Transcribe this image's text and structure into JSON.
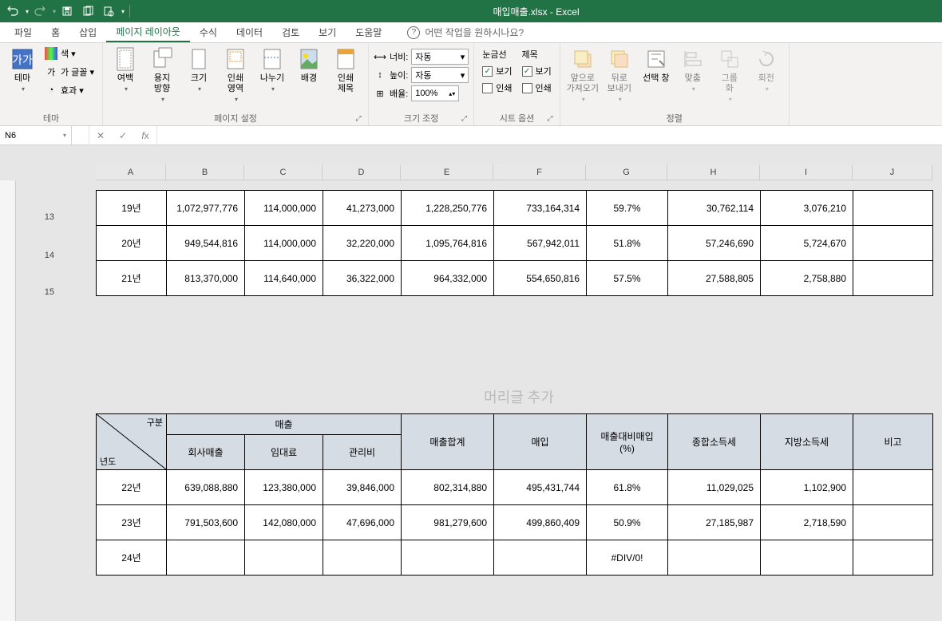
{
  "title": "매입매출.xlsx  -  Excel",
  "qat": {
    "undo": "↶",
    "redo": "↷",
    "save": "💾",
    "touch": "⎘",
    "preview": "🔍"
  },
  "tabs": [
    "파일",
    "홈",
    "삽입",
    "페이지 레이아웃",
    "수식",
    "데이터",
    "검토",
    "보기",
    "도움말"
  ],
  "active_tab": 3,
  "tell_me": "어떤 작업을 원하시나요?",
  "ribbon": {
    "theme": {
      "label": "테마",
      "btn": "테마",
      "colors": "색 ▾",
      "fonts": "가 글꼴 ▾",
      "effects": "효과 ▾"
    },
    "page_setup": {
      "label": "페이지 설정",
      "margins": "여백",
      "orient": "용지\n방향",
      "size": "크기",
      "area": "인쇄\n영역",
      "breaks": "나누기",
      "bg": "배경",
      "titles": "인쇄\n제목"
    },
    "scale": {
      "label": "크기 조정",
      "width": "너비:",
      "height": "높이:",
      "scale": "배율:",
      "auto": "자동",
      "pct": "100%"
    },
    "sheet_opts": {
      "label": "시트 옵션",
      "grid": "눈금선",
      "headings": "제목",
      "view": "보기",
      "print": "인쇄"
    },
    "arrange": {
      "label": "정렬",
      "forward": "앞으로\n가져오기",
      "back": "뒤로\n보내기",
      "selpane": "선택 창",
      "align": "맞춤",
      "group": "그룹\n화",
      "rotate": "회전"
    }
  },
  "namebox": "N6",
  "col_headers": [
    "A",
    "B",
    "C",
    "D",
    "E",
    "F",
    "G",
    "H",
    "I",
    "J"
  ],
  "row_numbers": [
    "13",
    "14",
    "15"
  ],
  "header_placeholder": "머리글 추가",
  "table1_rows": [
    {
      "year": "19년",
      "b": "1,072,977,776",
      "c": "114,000,000",
      "d": "41,273,000",
      "e": "1,228,250,776",
      "f": "733,164,314",
      "g": "59.7%",
      "h": "30,762,114",
      "i": "3,076,210"
    },
    {
      "year": "20년",
      "b": "949,544,816",
      "c": "114,000,000",
      "d": "32,220,000",
      "e": "1,095,764,816",
      "f": "567,942,011",
      "g": "51.8%",
      "h": "57,246,690",
      "i": "5,724,670"
    },
    {
      "year": "21년",
      "b": "813,370,000",
      "c": "114,640,000",
      "d": "36,322,000",
      "e": "964,332,000",
      "f": "554,650,816",
      "g": "57.5%",
      "h": "27,588,805",
      "i": "2,758,880"
    }
  ],
  "table2_headers": {
    "diag_top": "구분",
    "diag_bottom": "년도",
    "sales": "매출",
    "co_sales": "회사매출",
    "rent": "임대료",
    "mgmt": "관리비",
    "sum": "매출합계",
    "purchase": "매입",
    "ratio": "매출대비매입\n(%)",
    "itax": "종합소득세",
    "ltax": "지방소득세",
    "note": "비고"
  },
  "table2_rows": [
    {
      "year": "22년",
      "b": "639,088,880",
      "c": "123,380,000",
      "d": "39,846,000",
      "e": "802,314,880",
      "f": "495,431,744",
      "g": "61.8%",
      "h": "11,029,025",
      "i": "1,102,900"
    },
    {
      "year": "23년",
      "b": "791,503,600",
      "c": "142,080,000",
      "d": "47,696,000",
      "e": "981,279,600",
      "f": "499,860,409",
      "g": "50.9%",
      "h": "27,185,987",
      "i": "2,718,590"
    },
    {
      "year": "24년",
      "b": "",
      "c": "",
      "d": "",
      "e": "",
      "f": "",
      "g": "#DIV/0!",
      "h": "",
      "i": ""
    }
  ]
}
